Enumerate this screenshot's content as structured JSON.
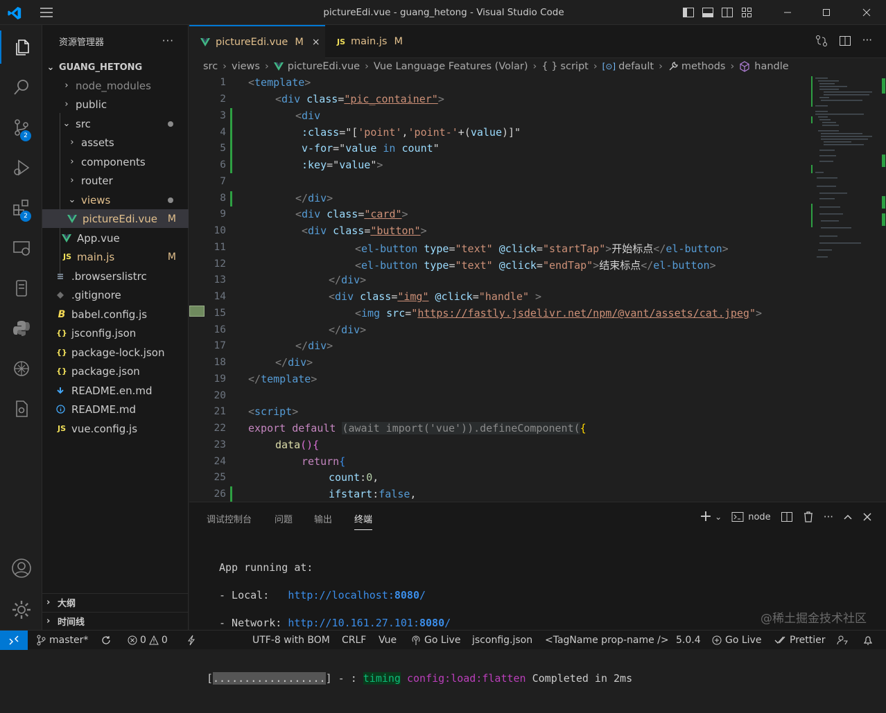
{
  "window": {
    "title": "pictureEdi.vue - guang_hetong - Visual Studio Code"
  },
  "explorer": {
    "title": "资源管理器",
    "root": "GUANG_HETONG",
    "items": [
      {
        "label": "node_modules",
        "icon": "chevron-right",
        "badge": ""
      },
      {
        "label": "public",
        "icon": "chevron-right",
        "badge": ""
      },
      {
        "label": "src",
        "icon": "chevron-down",
        "badge": "•"
      },
      {
        "label": "assets",
        "icon": "chevron-right",
        "badge": ""
      },
      {
        "label": "components",
        "icon": "chevron-right",
        "badge": ""
      },
      {
        "label": "router",
        "icon": "chevron-right",
        "badge": ""
      },
      {
        "label": "views",
        "icon": "chevron-down",
        "badge": "•"
      },
      {
        "label": "pictureEdi.vue",
        "icon": "vue-icon",
        "badge": "M"
      },
      {
        "label": "App.vue",
        "icon": "vue-icon",
        "badge": ""
      },
      {
        "label": "main.js",
        "icon": "js-icon",
        "badge": "M"
      },
      {
        "label": ".browserslistrc",
        "icon": "list-icon",
        "badge": ""
      },
      {
        "label": ".gitignore",
        "icon": "git-icon",
        "badge": ""
      },
      {
        "label": "babel.config.js",
        "icon": "babel-icon",
        "badge": ""
      },
      {
        "label": "jsconfig.json",
        "icon": "json-icon",
        "badge": ""
      },
      {
        "label": "package-lock.json",
        "icon": "json-icon",
        "badge": ""
      },
      {
        "label": "package.json",
        "icon": "json-icon",
        "badge": ""
      },
      {
        "label": "README.en.md",
        "icon": "markdown-icon",
        "badge": ""
      },
      {
        "label": "README.md",
        "icon": "info-icon",
        "badge": ""
      },
      {
        "label": "vue.config.js",
        "icon": "js-icon",
        "badge": ""
      }
    ],
    "outline": "大纲",
    "timeline": "时间线"
  },
  "activity": {
    "scm_badge": "2",
    "extensions_badge": "2"
  },
  "tabs": [
    {
      "label": "pictureEdi.vue",
      "badge": "M",
      "close": "×"
    },
    {
      "label": "main.js",
      "badge": "M"
    }
  ],
  "tab_icons": {
    "js": "JS"
  },
  "breadcrumb": [
    "src",
    "views",
    "pictureEdi.vue",
    "Vue Language Features (Volar)",
    "script",
    "default",
    "methods",
    "handle"
  ],
  "breadcrumb_icons": {
    "script": "{ }",
    "default": "[⊙]"
  },
  "code": {
    "line_numbers": [
      "1",
      "2",
      "3",
      "4",
      "5",
      "6",
      "7",
      "8",
      "9",
      "10",
      "11",
      "12",
      "13",
      "14",
      "15",
      "16",
      "17",
      "18",
      "19",
      "20",
      "21",
      "22",
      "23",
      "24",
      "25",
      "26"
    ],
    "l1": [
      "<",
      "template",
      ">"
    ],
    "l2": [
      "<",
      "div",
      "class",
      "=",
      "\"pic_container\"",
      ">"
    ],
    "l3": [
      "<",
      "div"
    ],
    "l4": [
      ":class",
      "=\"[",
      "'point'",
      ",",
      "'point-'",
      "+(",
      "value",
      ")]\""
    ],
    "l5": [
      "v-for",
      "=\"",
      "value",
      "in",
      "count",
      "\""
    ],
    "l6": [
      ":key",
      "=\"",
      "value",
      "\"",
      ">"
    ],
    "l8": [
      "</",
      "div",
      ">"
    ],
    "l9": [
      "<",
      "div",
      "class",
      "=",
      "\"card\"",
      ">"
    ],
    "l10": [
      "<",
      "div",
      "class",
      "=",
      "\"button\"",
      ">"
    ],
    "l11": [
      "<",
      "el-button",
      "type",
      "=",
      "\"text\"",
      "@click",
      "=",
      "\"startTap\"",
      ">",
      "开始标点",
      "</",
      "el-button",
      ">"
    ],
    "l12": [
      "<",
      "el-button",
      "type",
      "=",
      "\"text\"",
      "@click",
      "=",
      "\"endTap\"",
      ">",
      "结束标点",
      "</",
      "el-button",
      ">"
    ],
    "l13": [
      "</",
      "div",
      ">"
    ],
    "l14": [
      "<",
      "div",
      "class",
      "=",
      "\"img\"",
      "@click",
      "=",
      "\"handle\"",
      " >"
    ],
    "l15": [
      "<",
      "img",
      "src",
      "=",
      "\"",
      "https://fastly.jsdelivr.net/npm/@vant/assets/cat.jpeg",
      "\"",
      ">"
    ],
    "l16": [
      "</",
      "div",
      ">"
    ],
    "l17": [
      "</",
      "div",
      ">"
    ],
    "l18": [
      "</",
      "div",
      ">"
    ],
    "l19": [
      "</",
      "template",
      ">"
    ],
    "l21": [
      "<",
      "script",
      ">"
    ],
    "l22": [
      "export",
      "default",
      "(await import('vue')).defineComponent(",
      "{"
    ],
    "l23": [
      "data",
      "(){"
    ],
    "l24": [
      "return",
      "{"
    ],
    "l25": [
      "count",
      ":",
      "0",
      ","
    ],
    "l26": [
      "ifstart",
      ":",
      "false",
      ","
    ]
  },
  "panel": {
    "tabs": [
      "调试控制台",
      "问题",
      "输出",
      "终端"
    ],
    "shell": "node",
    "terminal": {
      "line1": "App running at:",
      "local_label": "- Local:   ",
      "local_url_prefix": "http://localhost:",
      "local_port": "8080",
      "local_url_suffix": "/",
      "network_label": "- Network: ",
      "network_url_prefix": "http://10.161.27.101:",
      "network_port": "8080",
      "network_url_suffix": "/",
      "progress_open": "[",
      "progress": "..................",
      "progress_close": "] - :",
      "timing": "timing",
      "config": "config:load:flatten",
      "completed": "Completed in 2ms"
    },
    "watermark": "@稀土掘金技术社区"
  },
  "status": {
    "branch": "master*",
    "errors": "0",
    "warnings": "0",
    "encoding": "UTF-8 with BOM",
    "eol": "CRLF",
    "language": "Vue",
    "golive1": "Go Live",
    "jsconfig": "jsconfig.json",
    "tagname": "<TagName prop-name />",
    "version": "5.0.4",
    "golive2": "Go Live",
    "prettier": "Prettier"
  },
  "colors": {
    "accent": "#0078d4",
    "modified": "#e2c08d",
    "vue": "#41b883",
    "js": "#f1e05a"
  }
}
